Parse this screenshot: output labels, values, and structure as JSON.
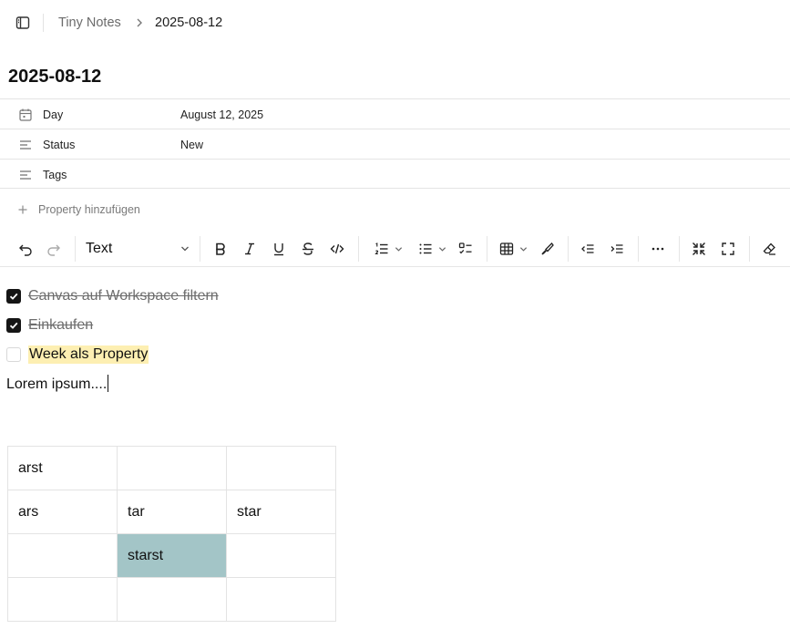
{
  "breadcrumb": {
    "root": "Tiny Notes",
    "current": "2025-08-12"
  },
  "page": {
    "title": "2025-08-12"
  },
  "properties": [
    {
      "icon": "calendar-icon",
      "label": "Day",
      "value": "August 12, 2025"
    },
    {
      "icon": "text-lines-icon",
      "label": "Status",
      "value": "New"
    },
    {
      "icon": "text-lines-icon",
      "label": "Tags",
      "value": ""
    }
  ],
  "add_property_label": "Property hinzufügen",
  "toolbar": {
    "block_type": "Text",
    "buttons": [
      "undo-icon",
      "redo-icon",
      "bold-icon",
      "italic-icon",
      "underline-icon",
      "strikethrough-icon",
      "code-icon",
      "ordered-list-icon",
      "bullet-list-icon",
      "task-list-icon",
      "table-icon",
      "highlighter-icon",
      "outdent-icon",
      "indent-icon",
      "more-icon",
      "collapse-icon",
      "fullscreen-icon",
      "clear-format-icon"
    ]
  },
  "editor": {
    "tasks": [
      {
        "text": "Canvas auf Workspace filtern",
        "checked": true
      },
      {
        "text": "Einkaufen",
        "checked": true
      },
      {
        "text": "Week als Property",
        "checked": false,
        "highlight": "#fdefb2"
      }
    ],
    "paragraph": "Lorem ipsum....",
    "table": [
      [
        "arst",
        "",
        ""
      ],
      [
        "ars",
        "tar",
        "star"
      ],
      [
        "",
        "starst",
        ""
      ],
      [
        "",
        "",
        ""
      ]
    ],
    "selected_cell_color": "#a3c5c7"
  }
}
